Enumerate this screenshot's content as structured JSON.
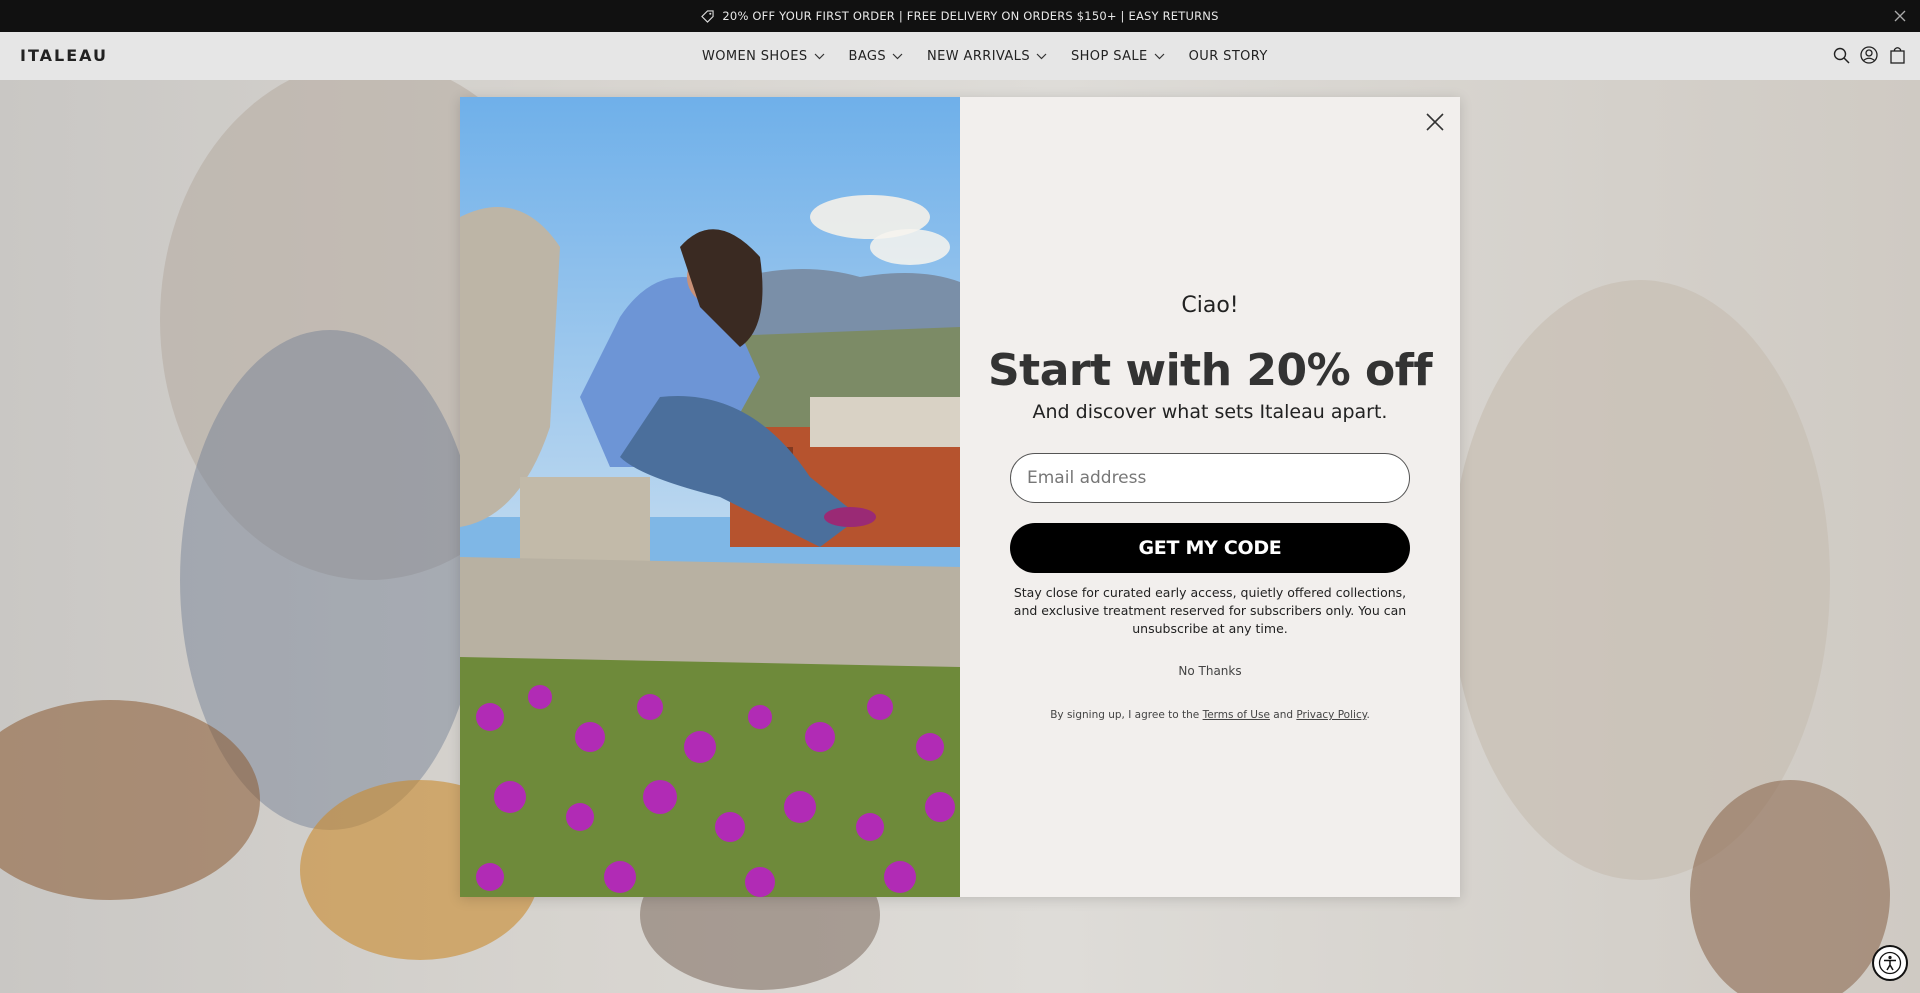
{
  "announcement": {
    "text": "20% OFF YOUR FIRST ORDER | FREE DELIVERY ON ORDERS $150+ | EASY RETURNS",
    "icon": "tag-icon"
  },
  "header": {
    "logo": "ITALEAU",
    "nav": [
      {
        "label": "WOMEN SHOES",
        "dropdown": true
      },
      {
        "label": "BAGS",
        "dropdown": true
      },
      {
        "label": "NEW ARRIVALS",
        "dropdown": true
      },
      {
        "label": "SHOP SALE",
        "dropdown": true
      },
      {
        "label": "OUR STORY",
        "dropdown": false
      }
    ],
    "icons": [
      "search-icon",
      "account-icon",
      "cart-icon"
    ]
  },
  "modal": {
    "greeting": "Ciao!",
    "headline": "Start with 20% off",
    "subhead": "And discover what sets Italeau apart.",
    "email_placeholder": "Email address",
    "cta_label": "GET MY CODE",
    "description": "Stay close for curated early access, quietly offered collections, and exclusive treatment reserved for subscribers only. You can unsubscribe at any time.",
    "no_thanks": "No Thanks",
    "legal_prefix": "By signing up, I agree to the",
    "terms_label": "Terms of Use",
    "legal_and": "and",
    "privacy_label": "Privacy Policy",
    "legal_suffix": "."
  },
  "colors": {
    "announcement_bg": "#111111",
    "header_bg": "#e6e6e6",
    "modal_bg": "#f2efed",
    "cta_bg": "#000000"
  }
}
